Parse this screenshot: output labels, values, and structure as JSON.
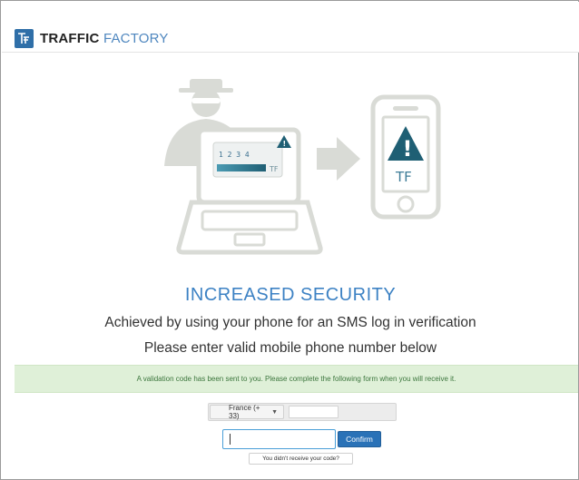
{
  "header": {
    "brand_primary": "TRAFFIC",
    "brand_secondary": "FACTORY",
    "logo_glyph": "TF"
  },
  "illustration": {
    "laptop_screen_digits": "1 2 3 4",
    "laptop_logo": "TF",
    "phone_logo": "TF",
    "warning_glyph": "!"
  },
  "content": {
    "title": "INCREASED SECURITY",
    "subtitle_1": "Achieved by using your phone for an SMS log in verification",
    "subtitle_2": "Please enter valid mobile phone number below"
  },
  "alert": {
    "message": "A validation code has been sent to you. Please complete the following form when you will receive it."
  },
  "form": {
    "country_selected": "France (+ 33)",
    "phone_value": "",
    "code_value": "",
    "confirm_label": "Confirm",
    "resend_label": "You didn't receive your code?"
  },
  "colors": {
    "brand_blue": "#2f6fa8",
    "title_blue": "#3d82c4",
    "alert_bg": "#dff0d8",
    "button_blue": "#2a72b7",
    "illustration_gray": "#d9dbd6",
    "warning_teal": "#1f5f74"
  }
}
